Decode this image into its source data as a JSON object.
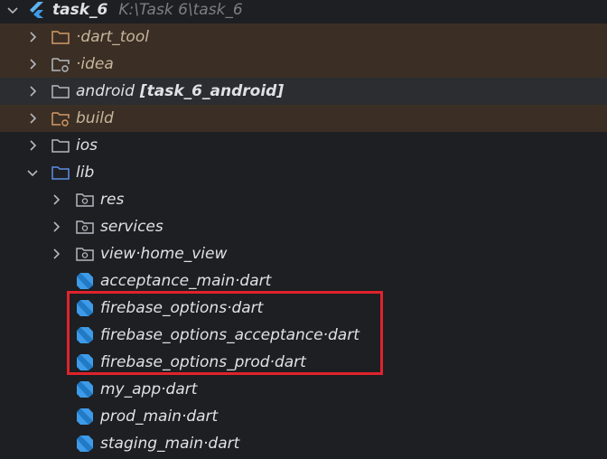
{
  "project": {
    "name": "task_6",
    "path": "K:\\Task 6\\task_6"
  },
  "items": {
    "dart_tool": "·dart_tool",
    "idea": "·idea",
    "android": "android",
    "android_module": "[task_6_android]",
    "build": "build",
    "ios": "ios",
    "lib": "lib",
    "res": "res",
    "services": "services",
    "view": "view·home_view",
    "acceptance_main": "acceptance_main·dart",
    "firebase_options": "firebase_options·dart",
    "firebase_options_acceptance": "firebase_options_acceptance·dart",
    "firebase_options_prod": "firebase_options_prod·dart",
    "my_app": "my_app·dart",
    "prod_main": "prod_main·dart",
    "staging_main": "staging_main·dart"
  },
  "icons": {
    "folder": "folder-icon",
    "dart_file": "dart-file-icon",
    "flutter": "flutter-logo-icon"
  },
  "colors": {
    "background": "#1e1f22",
    "excluded_row": "#3b2f25",
    "selected_row": "#2b2d30",
    "excluded_folder": "#d19a66",
    "source_folder": "#5c8ee6",
    "dart_icon": "#3d9be9",
    "highlight_box": "#e0232d"
  }
}
